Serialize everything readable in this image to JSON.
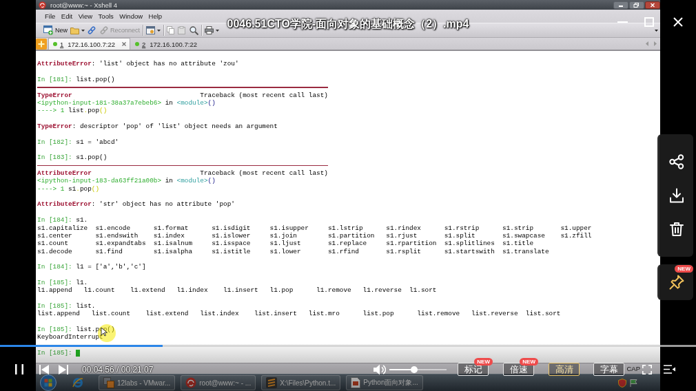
{
  "player": {
    "title": "0046.51CTO学院-面向对象的基础概念（2）.mp4",
    "playing": true,
    "progress": {
      "level": 0.234
    },
    "time": "00:04:56 / 00:21:07",
    "volume": {
      "level": 0.43
    },
    "buttons": [
      {
        "label": "标记",
        "badge": "NEW",
        "selected": false
      },
      {
        "label": "倍速",
        "badge": "NEW",
        "selected": false
      },
      {
        "label": "高清",
        "selected": true
      },
      {
        "label": "字幕",
        "selected": false
      }
    ],
    "pin": {
      "badge": "NEW"
    }
  },
  "xshell": {
    "title": "root@www:~ - Xshell 4",
    "menu": [
      "File",
      "Edit",
      "View",
      "Tools",
      "Window",
      "Help"
    ],
    "toolbar": {
      "new_button": {
        "label": "New"
      },
      "reconnect_button": {
        "label": "Reconnect",
        "disabled": true
      },
      "copy_button": {
        "disabled": true
      },
      "paste_button": {
        "disabled": true
      }
    },
    "tabs": [
      {
        "number": "1",
        "address": "172.16.100.7:22",
        "selected": true,
        "connected": true
      },
      {
        "number": "2",
        "address": "172.16.100.7:22",
        "selected": false,
        "connected": true
      }
    ],
    "terminal": {
      "lines": [
        {
          "kind": "error",
          "text": "**AttributeError**: 'list' object has no attribute 'zou'"
        },
        {
          "kind": "blank"
        },
        {
          "kind": "input",
          "prompt": "In [181]:",
          "code": "list.pop()",
          "cursor": false
        },
        {
          "kind": "divider"
        },
        {
          "kind": "traceback_header",
          "error": "TypeError",
          "label": "Traceback (most recent call last)"
        },
        {
          "kind": "location",
          "source": "<ipython-input-181-38a37a7ebeb6>",
          "keyword": "in",
          "scope": "<module>",
          "call": "()"
        },
        {
          "kind": "source_line",
          "arrow": "---->",
          "number": "1",
          "code": [
            {
              "kind": "name",
              "text": "list"
            },
            {
              "kind": "operator",
              "text": "."
            },
            {
              "kind": "name",
              "text": "pop"
            },
            {
              "kind": "operator",
              "text": "()"
            }
          ]
        },
        {
          "kind": "blank"
        },
        {
          "kind": "error",
          "text": "**TypeError**: descriptor 'pop' of 'list' object needs an argument"
        },
        {
          "kind": "blank"
        },
        {
          "kind": "input",
          "prompt": "In [182]:",
          "code": "s1 = 'abcd'",
          "cursor": false
        },
        {
          "kind": "blank"
        },
        {
          "kind": "input",
          "prompt": "In [183]:",
          "code": "s1.pop()",
          "cursor": false
        },
        {
          "kind": "divider"
        },
        {
          "kind": "traceback_header",
          "error": "AttributeError",
          "label": "Traceback (most recent call last)"
        },
        {
          "kind": "location",
          "source": "<ipython-input-183-da63ff21a00b>",
          "keyword": "in",
          "scope": "<module>",
          "call": "()"
        },
        {
          "kind": "source_line",
          "arrow": "---->",
          "number": "1",
          "code": [
            {
              "kind": "name",
              "text": "s1"
            },
            {
              "kind": "operator",
              "text": "."
            },
            {
              "kind": "name",
              "text": "pop"
            },
            {
              "kind": "operator",
              "text": "()"
            }
          ]
        },
        {
          "kind": "blank"
        },
        {
          "kind": "error",
          "text": "**AttributeError**: 'str' object has no attribute 'pop'"
        },
        {
          "kind": "blank"
        },
        {
          "kind": "input",
          "prompt": "In [184]:",
          "code": "s1.",
          "cursor": false
        },
        {
          "kind": "completions",
          "rows": [
            [
              "s1.capitalize",
              "s1.encode",
              "s1.format",
              "s1.isdigit",
              "s1.isupper",
              "s1.lstrip",
              "s1.rindex",
              "s1.rstrip",
              "s1.strip",
              "s1.upper"
            ],
            [
              "s1.center",
              "s1.endswith",
              "s1.index",
              "s1.islower",
              "s1.join",
              "s1.partition",
              "s1.rjust",
              "s1.split",
              "s1.swapcase",
              "s1.zfill"
            ],
            [
              "s1.count",
              "s1.expandtabs",
              "s1.isalnum",
              "s1.isspace",
              "s1.ljust",
              "s1.replace",
              "s1.rpartition",
              "s1.splitlines",
              "s1.title"
            ],
            [
              "s1.decode",
              "s1.find",
              "s1.isalpha",
              "s1.istitle",
              "s1.lower",
              "s1.rfind",
              "s1.rsplit",
              "s1.startswith",
              "s1.translate"
            ]
          ]
        },
        {
          "kind": "blank"
        },
        {
          "kind": "input",
          "prompt": "In [184]:",
          "code": "l1 = ['a','b','c']",
          "cursor": false
        },
        {
          "kind": "blank"
        },
        {
          "kind": "input",
          "prompt": "In [185]:",
          "code": "l1.",
          "cursor": false
        },
        {
          "kind": "completions",
          "rows": [
            [
              "l1.append",
              "l1.count",
              "l1.extend",
              "l1.index",
              "l1.insert",
              "l1.pop",
              "l1.remove",
              "l1.reverse",
              "l1.sort"
            ]
          ]
        },
        {
          "kind": "blank"
        },
        {
          "kind": "input",
          "prompt": "In [185]:",
          "code": "list.",
          "cursor": false
        },
        {
          "kind": "completions",
          "rows": [
            [
              "list.append",
              "list.count",
              "list.extend",
              "list.index",
              "list.insert",
              "list.mro",
              "list.pop",
              "list.remove",
              "list.reverse",
              "list.sort"
            ]
          ]
        },
        {
          "kind": "blank"
        },
        {
          "kind": "input",
          "prompt": "In [185]:",
          "code": "list.pop()",
          "cursor": false
        },
        {
          "kind": "output",
          "text": "KeyboardInterrupt"
        },
        {
          "kind": "blank"
        },
        {
          "kind": "input",
          "prompt": "In [185]:",
          "cursor": true
        }
      ]
    },
    "status_bar": {
      "indicators": [
        "CAP"
      ]
    }
  },
  "taskbar": {
    "items": [
      {
        "label": "12labs - VMwar..."
      },
      {
        "label": "root@www:~ - ..."
      },
      {
        "label": "X:\\Files\\Python.t..."
      },
      {
        "label": "Python面向对象..."
      }
    ]
  }
}
